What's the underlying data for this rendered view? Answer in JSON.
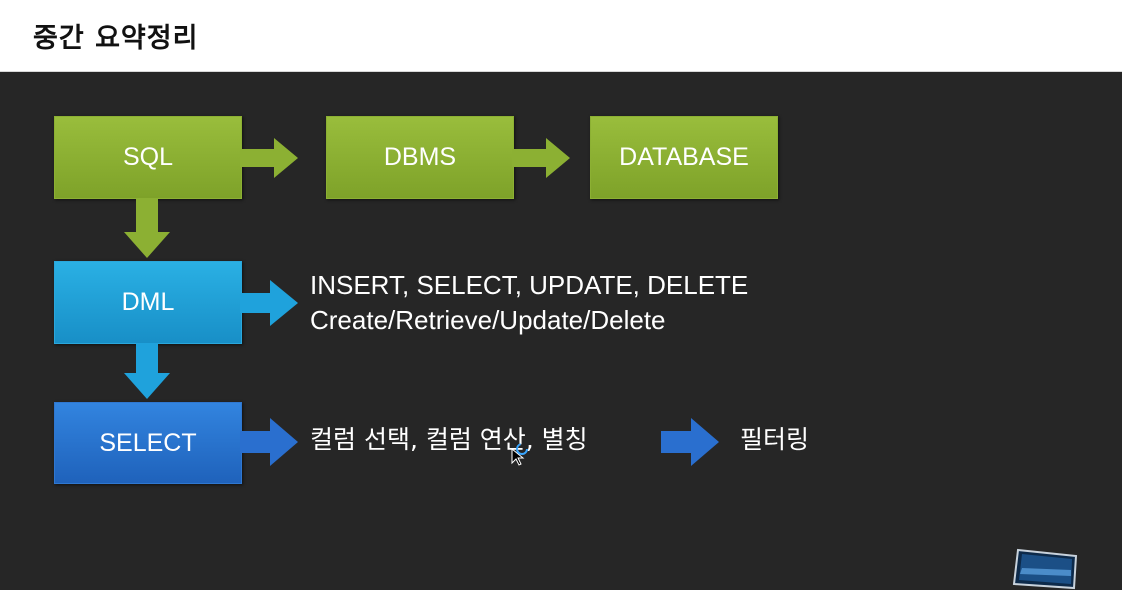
{
  "header": {
    "title": "중간 요약정리"
  },
  "boxes": {
    "sql": "SQL",
    "dbms": "DBMS",
    "database": "DATABASE",
    "dml": "DML",
    "select": "SELECT"
  },
  "dml_text": {
    "line1": "INSERT, SELECT, UPDATE, DELETE",
    "line2": "Create/Retrieve/Update/Delete"
  },
  "select_text": {
    "ops": "컬럼 선택, 컬럼 연산, 별칭",
    "next": "필터링"
  },
  "colors": {
    "green": "#8cb033",
    "cyan": "#1fa2dc",
    "blue": "#2a6fcf",
    "background": "#262626"
  },
  "icons": [
    "arrow-right-icon",
    "arrow-down-icon",
    "mouse-cursor-icon",
    "busy-indicator-icon"
  ]
}
